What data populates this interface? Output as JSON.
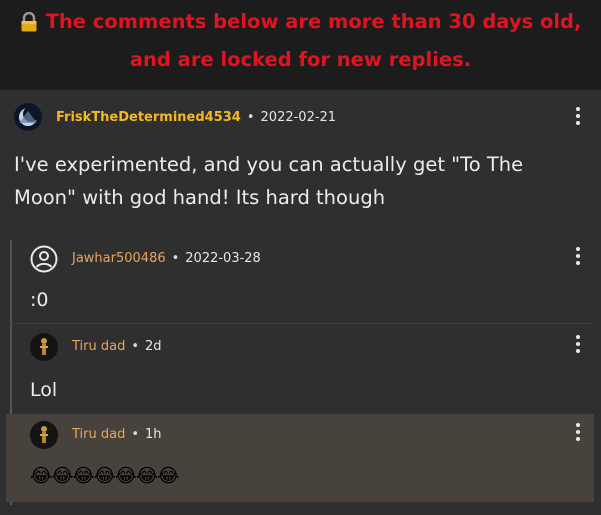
{
  "banner": {
    "line1": "The comments below are more than 30 days old,",
    "line2": "and are locked for new replies.",
    "color": "#e0131f",
    "icon": "lock-icon"
  },
  "comment": {
    "username": "FriskTheDetermined4534",
    "separator": "•",
    "date": "2022-02-21",
    "text_line1": "I've experimented, and you can actually get \"To The",
    "text_line2": "Moon\" with god hand! Its hard though",
    "avatar_icon": "moon-avatar-icon",
    "menu_icon": "more-options-icon"
  },
  "replies": [
    {
      "username": "Jawhar500486",
      "separator": "•",
      "date": "2022-03-28",
      "text": ":0",
      "avatar_icon": "default-user-icon"
    },
    {
      "username": "Tiru dad",
      "separator": "•",
      "date": "2d",
      "text": "Lol",
      "avatar_icon": "figure-avatar-icon"
    },
    {
      "username": "Tiru dad",
      "separator": "•",
      "date": "1h",
      "text": "😂😂😂😂😂😂😂",
      "avatar_icon": "figure-avatar-icon"
    }
  ],
  "colors": {
    "background": "#2f2f2f",
    "banner_bg": "#1c1c1c",
    "main_username": "#f5b920",
    "reply_username": "#e6a55e",
    "highlight_bg": "#48423c"
  }
}
